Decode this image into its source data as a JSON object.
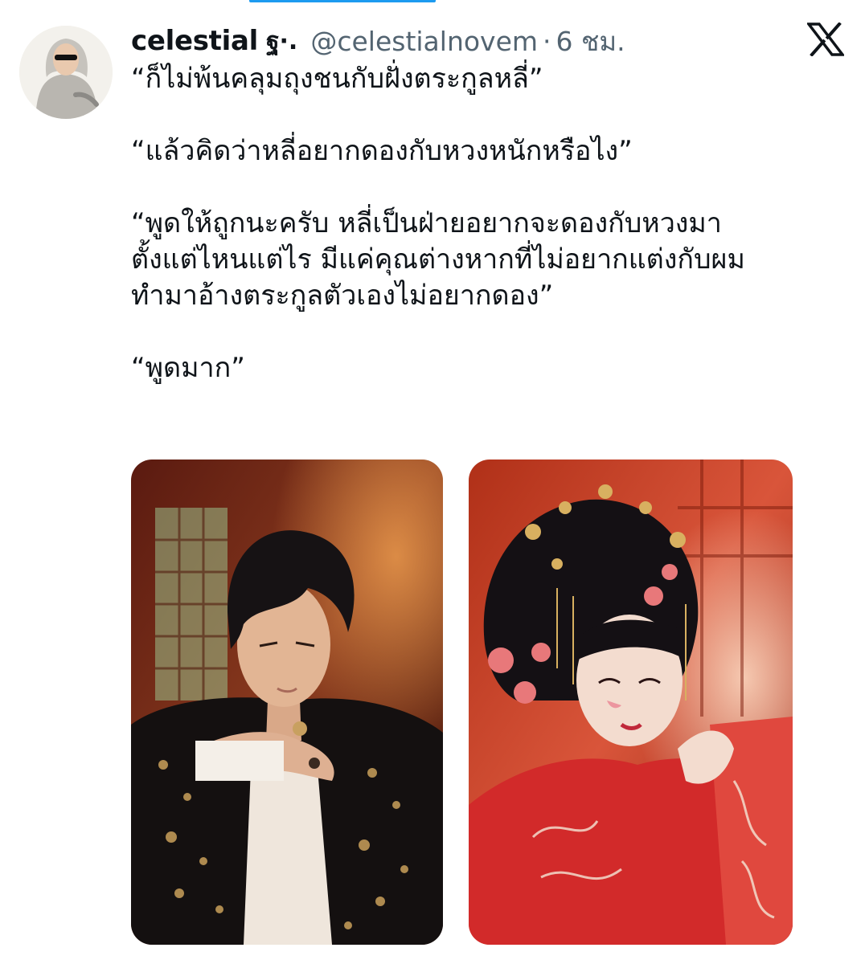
{
  "tweet": {
    "author": {
      "display_name": "celestial",
      "name_decoration": "ฐ·.",
      "handle": "@celestialnovem",
      "separator": "·",
      "time": "6 ชม."
    },
    "brand_icon": "x-logo-icon",
    "lines": [
      {
        "text": "“ก็ไม่พ้นคลุมถุงชนกับฝั่งตระกูลหลี่”"
      },
      {
        "text": "“แล้วคิดว่าหลี่อยากดองกับหวงหนักหรือไง”"
      },
      {
        "text": "“พูดให้ถูกนะครับ หลี่เป็นฝ่ายอยากจะดองกับหวงมา"
      },
      {
        "text": "ตั้งแต่ไหนแต่ไร มีแค่คุณต่างหากที่ไม่อยากแต่งกับผม"
      },
      {
        "text": "ทำมาอ้างตระกูลตัวเองไม่อยากดอง”"
      },
      {
        "text": "“พูดมาก”"
      }
    ],
    "media": [
      {
        "icon": "photo-man-black-gold-jacket"
      },
      {
        "icon": "photo-woman-red-hanfu-headdress"
      }
    ]
  },
  "colors": {
    "text_primary": "#0f1419",
    "text_secondary": "#536471",
    "accent": "#1d9bf0",
    "background": "#ffffff"
  }
}
